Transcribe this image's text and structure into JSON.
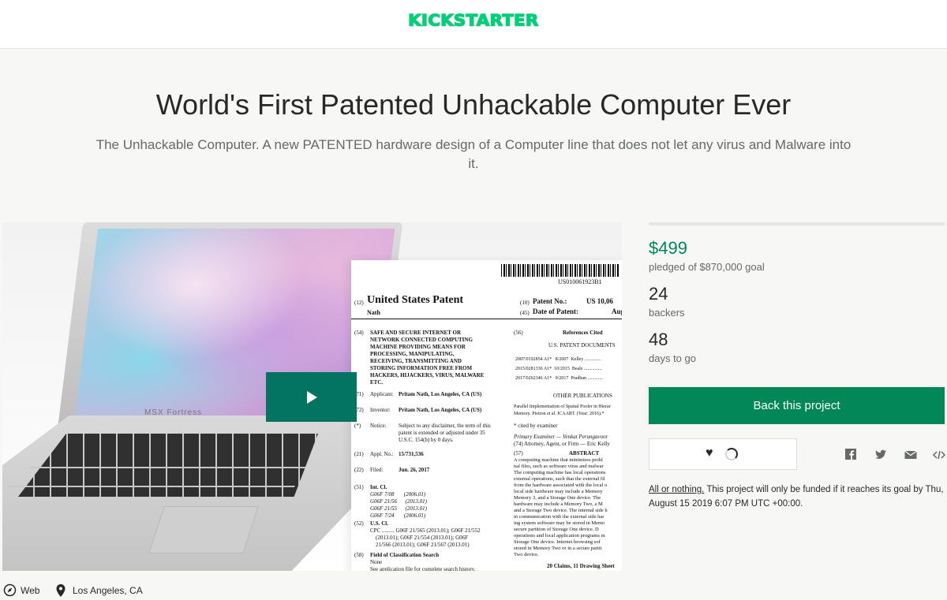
{
  "header": {
    "logo_text": "KICKSTARTER",
    "brand_color": "#05ce78"
  },
  "project": {
    "title": "World's First Patented Unhackable Computer Ever",
    "subtitle": "The Unhackable Computer. A new PATENTED hardware design of a Computer line that does not let any virus and Malware into it."
  },
  "media": {
    "laptop_brand": "MSX Fortress",
    "play_icon": "play-icon",
    "patent": {
      "barcode_number": "US010061923B1",
      "label_12": "(12)",
      "title": "United States Patent",
      "inventor_surname": "Nath",
      "label_10": "(10)",
      "patent_no_label": "Patent No.:",
      "patent_no_value": "US 10,06",
      "label_45": "(45)",
      "date_label": "Date of Patent:",
      "date_value": "Aug",
      "label_54": "(54)",
      "invention_title": "SAFE AND SECURE INTERNET OR\nNETWORK CONNECTED COMPUTING\nMACHINE PROVIDING MEANS FOR\nPROCESSING, MANIPULATING,\nRECEIVING, TRANSMITTING AND\nSTORING INFORMATION FREE FROM\nHACKERS, HIJACKERS, VIRUS, MALWARE\nETC.",
      "label_56": "(56)",
      "references_heading": "References Cited",
      "us_patent_docs": "U.S. PATENT DOCUMENTS",
      "references": "2007/0192854 A1*   8/2007  Kelley ..............\n2015/0281336 A1*  10/2015  Beale ...............\n2017/0262346 A1*   9/2017  Pradhan .............",
      "other_publications": "OTHER PUBLICATIONS",
      "publication_text": "Parallel Implementation of Spatial Pooler in Hierar\nMemory. Pietron et al. ICAART. (Year: 2016).*",
      "cited_by_examiner": "* cited by examiner",
      "primary_examiner": "Primary Examiner — Venkat Perungavoor",
      "attorney": "(74) Attorney, Agent, or Firm — Eric Kelly",
      "label_57": "(57)",
      "abstract_heading": "ABSTRACT",
      "abstract_text": "A computing machine that minimizes probl\nnal files, such as software virus and malwar\nThe computing machine has local operations\nexternal operations, such that the external fil\nfrom the hardware associated with the local o\nlocal side hardware may include a Memory\nMemory 3, and a Storage One device. The\nhardware may include a Memory Two, a M\nand a Storage Two device. The internal side h\nin communication with the external side har\ning system software may be stored in Memo\nsecure partition of Storage One device. D\noperations and local application programs m\nStorage One device. Internet browsing sof\nstored in Memory Two or in a secure partit\nTwo device.",
      "claims_line": "20 Claims, 11 Drawing Sheet",
      "applicant_label": "(71)",
      "applicant_title": "Applicant:",
      "applicant_value": "Pritam Nath, Los Angeles, CA (US)",
      "inventor_label": "(72)",
      "inventor_title": "Inventor:",
      "inventor_value": "Pritam Nath, Los Angeles, CA (US)",
      "notice_label": "(*)",
      "notice_title": "Notice:",
      "notice_value": "Subject to any disclaimer, the term of this\npatent is extended or adjusted under 35\nU.S.C. 154(b) by 0 days.",
      "appl_label": "(21)",
      "appl_title": "Appl. No.:",
      "appl_value": "15/731,536",
      "filed_label": "(22)",
      "filed_title": "Filed:",
      "filed_value": "Jun. 26, 2017",
      "intcl_label": "(51)",
      "intcl_title": "Int. Cl.",
      "intcl_value": "G06F 7/08       (2006.01)\nG06F 21/56      (2013.01)\nG06F 21/55      (2013.01)\nG06F 7/24       (2006.01)",
      "uscl_label": "(52)",
      "uscl_title": "U.S. Cl.",
      "uscl_value": "CPC ......... G06F 21/565 (2013.01); G06F 21/552\n    (2013.01); G06F 21/554 (2013.01); G06F\n    21/566 (2013.01); G06F 21/567 (2013.01)",
      "field_label": "(58)",
      "field_title": "Field of Classification Search",
      "field_value": "None\nSee application file for complete search history."
    }
  },
  "stats": {
    "pledged_amount": "$499",
    "pledged_label": "pledged of $870,000 goal",
    "backers_count": "24",
    "backers_label": "backers",
    "days_count": "48",
    "days_label": "days to go",
    "funded_fraction": 0.0006
  },
  "actions": {
    "back_button": "Back this project",
    "remind_icon": "heart-icon",
    "share_icons": [
      "facebook-icon",
      "twitter-icon",
      "email-icon",
      "embed-icon"
    ]
  },
  "funding_note": {
    "link": "All or nothing.",
    "text": " This project will only be funded if it reaches its goal by Thu, August 15 2019 6:07 PM UTC +00:00."
  },
  "footer_meta": {
    "category": "Web",
    "location": "Los Angeles, CA"
  },
  "colors": {
    "accent": "#028858",
    "play_bg": "#037362",
    "muted": "#656969"
  }
}
